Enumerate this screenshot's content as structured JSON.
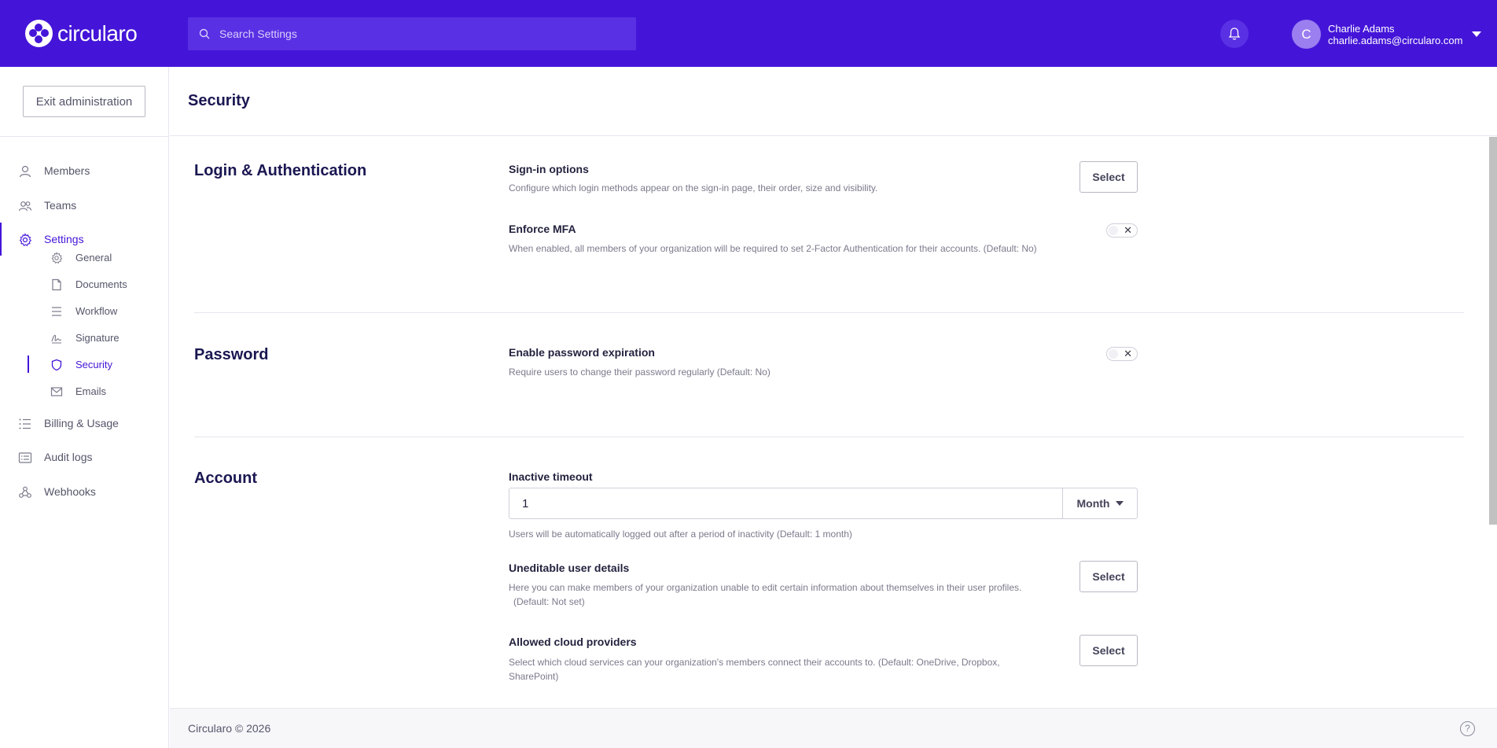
{
  "header": {
    "logo_text": "circularo",
    "search_placeholder": "Search Settings",
    "user": {
      "initial": "C",
      "name": "Charlie Adams",
      "email": "charlie.adams@circularo.com"
    },
    "colors": {
      "brand": "#4415d8",
      "search_bg": "#5a30e4"
    }
  },
  "sidebar": {
    "exit_label": "Exit administration",
    "items": [
      {
        "label": "Members",
        "icon": "user-icon"
      },
      {
        "label": "Teams",
        "icon": "users-icon"
      },
      {
        "label": "Settings",
        "icon": "gear-icon",
        "active": true
      },
      {
        "label": "Billing & Usage",
        "icon": "list-icon"
      },
      {
        "label": "Audit logs",
        "icon": "log-icon"
      },
      {
        "label": "Webhooks",
        "icon": "webhook-icon"
      }
    ],
    "sub_items": [
      {
        "label": "General",
        "icon": "gear-icon"
      },
      {
        "label": "Documents",
        "icon": "document-icon"
      },
      {
        "label": "Workflow",
        "icon": "lines-icon"
      },
      {
        "label": "Signature",
        "icon": "signature-icon"
      },
      {
        "label": "Security",
        "icon": "shield-icon",
        "active": true
      },
      {
        "label": "Emails",
        "icon": "mail-icon"
      }
    ]
  },
  "page": {
    "title": "Security"
  },
  "sections": {
    "login": {
      "title": "Login & Authentication",
      "signin": {
        "label": "Sign-in options",
        "desc": "Configure which login methods appear on the sign-in page, their order, size and visibility.",
        "button": "Select"
      },
      "mfa": {
        "label": "Enforce MFA",
        "desc": "When enabled, all members of your organization will be required to set 2-Factor Authentication for their accounts.  (Default: No)",
        "enabled": false
      }
    },
    "password": {
      "title": "Password",
      "expiration": {
        "label": "Enable password expiration",
        "desc": "Require users to change their password regularly  (Default: No)",
        "enabled": false
      }
    },
    "account": {
      "title": "Account",
      "timeout": {
        "label": "Inactive timeout",
        "value": "1",
        "unit": "Month",
        "desc": "Users will be automatically logged out after a period of inactivity  (Default: 1 month)"
      },
      "uneditable": {
        "label": "Uneditable user details",
        "desc_line1": "Here you can make members of your organization unable to edit certain information about themselves in their user profiles.",
        "desc_line2": "(Default: Not set)",
        "button": "Select"
      },
      "cloud": {
        "label": "Allowed cloud providers",
        "desc_line1": "Select which cloud services can your organization's members connect their accounts to.  (Default: OneDrive, Dropbox,",
        "desc_line2": "SharePoint)",
        "button": "Select"
      }
    }
  },
  "footer": {
    "text": "Circularo © 2026",
    "help_glyph": "?"
  }
}
